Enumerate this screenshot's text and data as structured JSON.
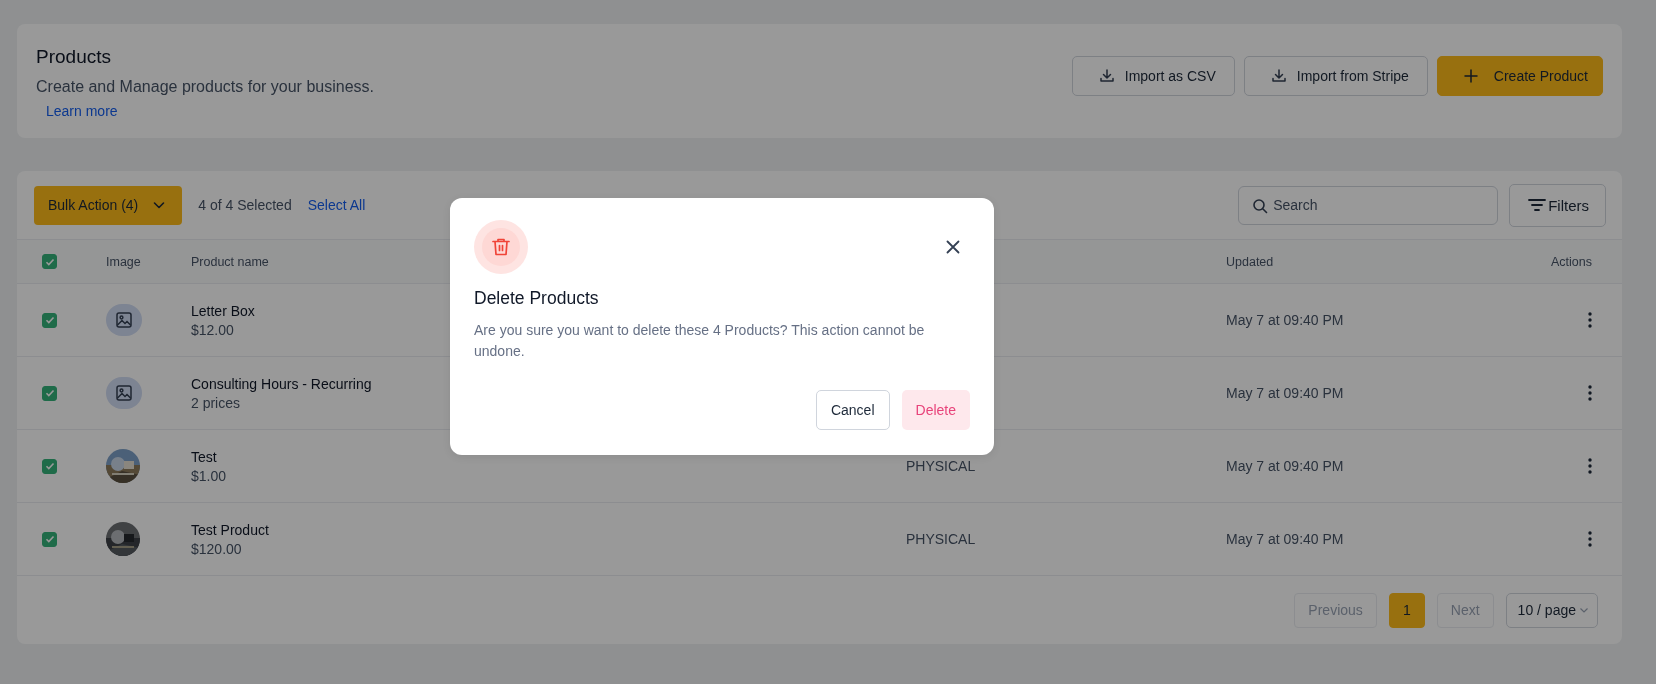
{
  "header": {
    "title": "Products",
    "subtitle": "Create and Manage products for your business.",
    "link": "Learn more",
    "buttons": [
      {
        "label": "Import as CSV",
        "kind": "import"
      },
      {
        "label": "Import from Stripe",
        "kind": "import"
      },
      {
        "label": "Create Product",
        "kind": "create"
      }
    ]
  },
  "toolbar": {
    "bulk_action": "Bulk Action (4)",
    "selected_count": "4 of 4 Selected",
    "select_all": "Select All",
    "search": {
      "placeholder": "Search"
    },
    "filters": "Filters"
  },
  "table": {
    "header_checked": true,
    "columns": {
      "image": "Image",
      "name": "Product name",
      "updated": "Updated",
      "actions": "Actions"
    },
    "rows": [
      {
        "checked": true,
        "kind": "placeholder",
        "name": "Letter Box",
        "price": "$12.00",
        "updated": "May 7 at 09:40 PM"
      },
      {
        "checked": true,
        "kind": "placeholder",
        "name": "Consulting Hours - Recurring",
        "price": "2 prices",
        "updated": "May 7 at 09:40 PM"
      },
      {
        "checked": true,
        "name": "Test",
        "price": "$1.00",
        "type": "PHYSICAL",
        "updated": "May 7 at 09:40 PM"
      },
      {
        "checked": true,
        "name": "Test Product",
        "price": "$120.00",
        "type": "PHYSICAL",
        "updated": "May 7 at 09:40 PM"
      }
    ]
  },
  "pagination": {
    "previous": {
      "label": "Previous",
      "disabled": true
    },
    "pages": [
      {
        "label": "1",
        "selected": true
      }
    ],
    "next": {
      "label": "Next",
      "disabled": true
    },
    "page_size": "10 / page"
  },
  "modal": {
    "title": "Delete Products",
    "message": "Are you sure you want to delete these 4 Products? This action cannot be undone.",
    "cancel": "Cancel",
    "confirm": "Delete"
  }
}
